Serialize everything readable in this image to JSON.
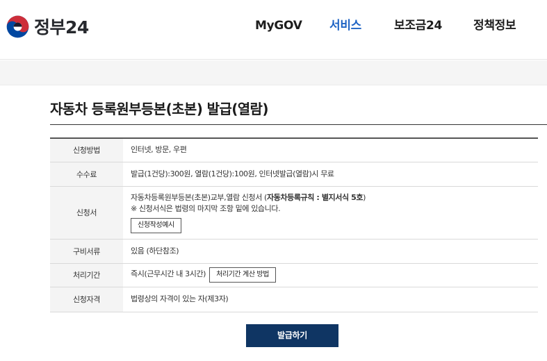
{
  "header": {
    "logo_text": "정부24",
    "nav": [
      "MyGOV",
      "서비스",
      "보조금24",
      "정책정보"
    ],
    "active_nav": "서비스"
  },
  "page": {
    "title": "자동차 등록원부등본(초본) 발급(열람)"
  },
  "table": {
    "method": {
      "label": "신청방법",
      "value": "인터넷, 방문, 우편"
    },
    "fee": {
      "label": "수수료",
      "value": "발급(1건당):300원, 열람(1건당):100원, 인터넷발급(열람)시 무료"
    },
    "application": {
      "label": "신청서",
      "line1_prefix": "자동차등록원부등본(초본)교부,열람 신청서 (",
      "line1_bold": "자동차등록규칙 : 별지서식 5호",
      "line1_suffix": ")",
      "line2": "※ 신청서식은 법령의 마지막 조항 밑에 있습니다.",
      "button": "신청작성예시"
    },
    "documents": {
      "label": "구비서류",
      "value": "있음 (하단참조)"
    },
    "period": {
      "label": "처리기간",
      "value": "즉시(근무시간 내 3시간)",
      "button": "처리기간 계산 방법"
    },
    "eligibility": {
      "label": "신청자격",
      "value": "법령상의 자격이 있는 자(제3자)"
    }
  },
  "actions": {
    "issue": "발급하기"
  },
  "colors": {
    "active_nav": "#1e63c4",
    "primary_button": "#0f3563",
    "logo_red": "#cd2e3a",
    "logo_blue": "#0047a0"
  }
}
